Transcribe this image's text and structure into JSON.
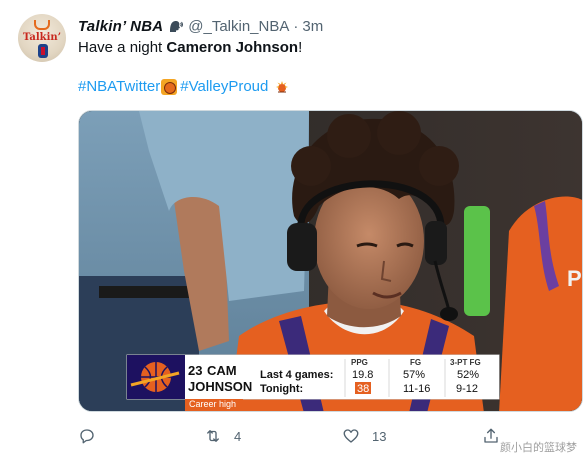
{
  "author": {
    "display_name": "Talkin’ NBA",
    "handle": "@_Talkin_NBA",
    "separator": "·",
    "time": "3m",
    "avatar_text": "Talkin’"
  },
  "tweet": {
    "text_prefix": "Have a night ",
    "text_bold": "Cameron Johnson",
    "text_suffix": "!",
    "hashtags": [
      "#NBATwitter",
      "#ValleyProud"
    ]
  },
  "media": {
    "scoreboard": {
      "jersey_number": "23",
      "first_name": "CAM",
      "last_name": "JOHNSON",
      "tag": "Career high",
      "headers": [
        "PPG",
        "FG",
        "3-PT FG"
      ],
      "rows": [
        {
          "label": "Last 4 games:",
          "ppg": "19.8",
          "fg": "57%",
          "three": "52%"
        },
        {
          "label": "Tonight:",
          "ppg": "38",
          "fg": "11-16",
          "three": "9-12"
        }
      ]
    },
    "colors": {
      "suns_orange": "#e56020",
      "suns_purple": "#1d1160",
      "scoreboard_bg": "#ffffff"
    }
  },
  "actions": {
    "reply": "",
    "retweets": "4",
    "likes": "13"
  },
  "watermark": "颜小白的篮球梦",
  "icons": [
    "speaking-head-icon",
    "suns-basketball-icon",
    "sun-icon",
    "reply-icon",
    "retweet-icon",
    "like-icon",
    "share-icon"
  ]
}
